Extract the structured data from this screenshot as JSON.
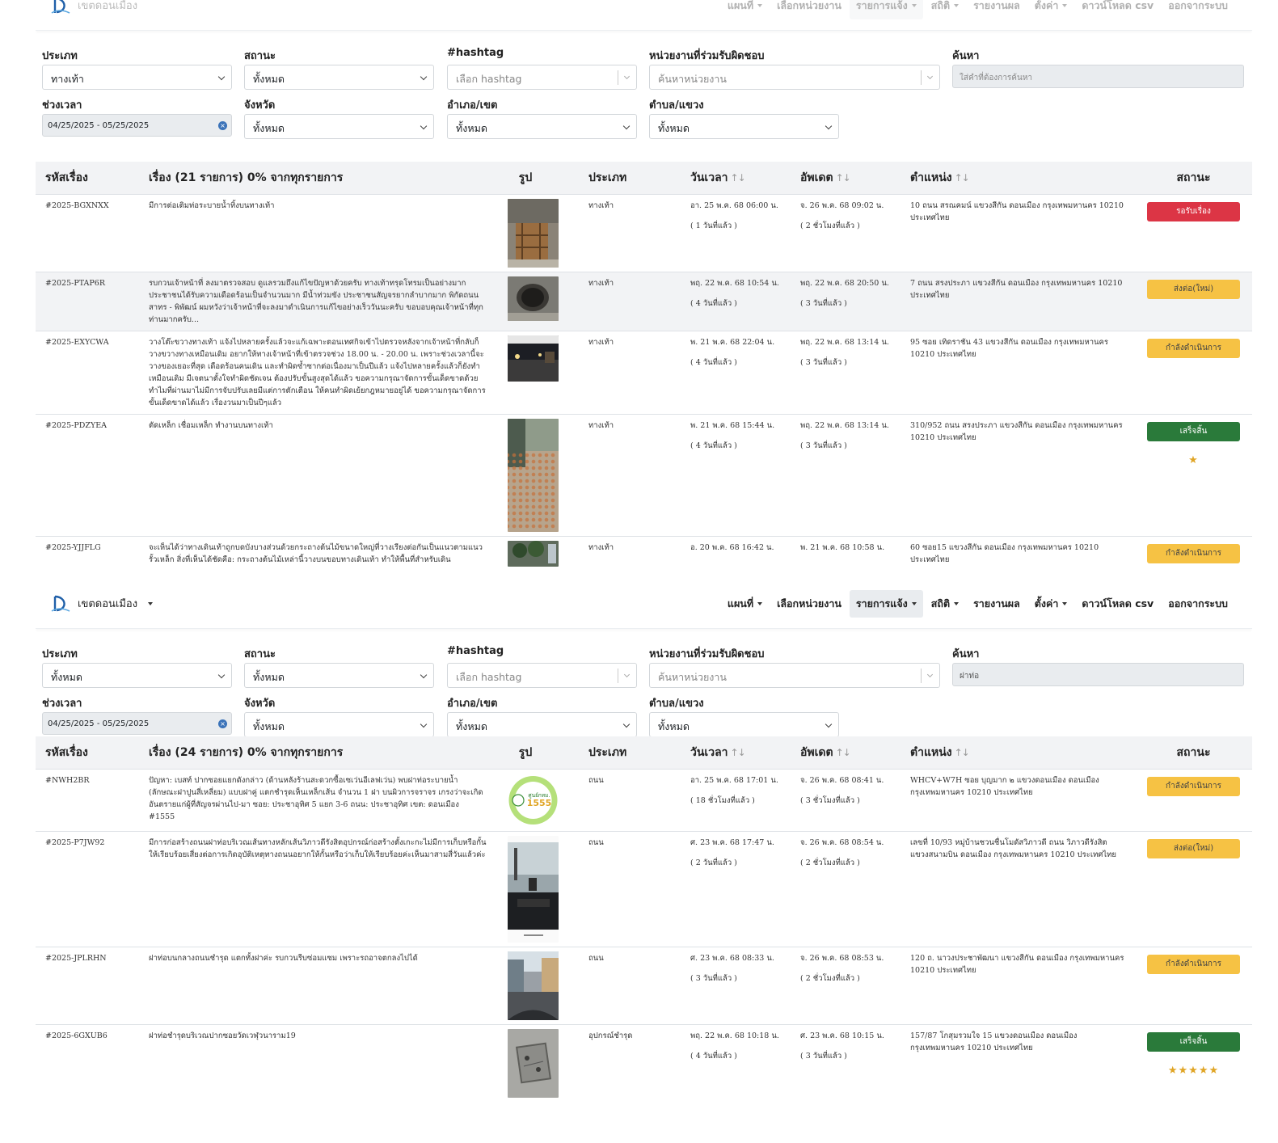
{
  "nav": {
    "brand_label": "เขตดอนเมือง",
    "items": [
      {
        "label": "แผนที่",
        "caret": true
      },
      {
        "label": "เลือกหน่วยงาน",
        "caret": false
      },
      {
        "label": "รายการแจ้ง",
        "caret": true,
        "active": true
      },
      {
        "label": "สถิติ",
        "caret": true
      },
      {
        "label": "รายงานผล",
        "caret": false
      },
      {
        "label": "ตั้งค่า",
        "caret": true
      },
      {
        "label": "ดาวน์โหลด csv",
        "caret": false
      },
      {
        "label": "ออกจากระบบ",
        "caret": false
      }
    ]
  },
  "filter_labels": {
    "type": "ประเภท",
    "status": "สถานะ",
    "hashtag": "#hashtag",
    "agency": "หน่วยงานที่ร่วมรับผิดชอบ",
    "search": "ค้นหา",
    "period": "ช่วงเวลา",
    "province": "จังหวัด",
    "district": "อำเภอ/เขต",
    "subdistrict": "ตำบล/แขวง"
  },
  "filter_placeholders": {
    "hashtag": "เลือก hashtag",
    "agency": "ค้นหาหน่วยงาน",
    "search": "ใส่คำที่ต้องการค้นหา"
  },
  "table_headers": {
    "code": "รหัสเรื่อง",
    "image": "รูป",
    "type": "ประเภท",
    "time": "วันเวลา",
    "updated": "อัพเดต",
    "location": "ตำแหน่ง",
    "status": "สถานะ"
  },
  "colors": {
    "red": "#dc3545",
    "yellow": "#f6c244",
    "green": "#2a7a3a",
    "active_nav": "#e9ecef",
    "header_bg": "#f2f3f5"
  },
  "panel1": {
    "filters": {
      "type": "ทางเท้า",
      "status": "ทั้งหมด",
      "search": "",
      "period": "04/25/2025 - 05/25/2025",
      "province": "ทั้งหมด",
      "district": "ทั้งหมด",
      "subdistrict": "ทั้งหมด"
    },
    "summary": "เรื่อง (21 รายการ) 0% จากทุกรายการ",
    "rows": [
      {
        "code": "#2025-BGXNXX",
        "desc": "มีการต่อเติมท่อระบายน้ำทิ้งบนทางเท้า",
        "type": "ทางเท้า",
        "time": "อา. 25 พ.ค. 68 06:00 น.",
        "time_ago": "( 1 วันที่แล้ว )",
        "updated": "จ. 26 พ.ค. 68 09:02 น.",
        "updated_ago": "( 2 ชั่วโมงที่แล้ว )",
        "location": "10 ถนน สรณคมน์ แขวงสีกัน ดอนเมือง กรุงเทพมหานคร 10210 ประเทศไทย",
        "status": "รอรับเรื่อง",
        "status_color": "red",
        "stars": 0,
        "image": "sidewalk-pipes"
      },
      {
        "code": "#2025-PTAP6R",
        "desc": "รบกวนเจ้าหน้าที่ ลงมาตรวจสอบ ดูแลรวมถึงแก้ไขปัญหาด้วยครับ ทางเท้าทรุดโทรมเป็นอย่างมาก ประชาชนได้รับความเดือดร้อนเป็นจำนวนมาก มีน้ำท่วมขัง ประชาชนสัญจรยากลำบากมาก พิกัดถนนสาทร - พิพัฒน์ ผมหวังว่าเจ้าหน้าที่จะลงมาดำเนินการแก้ไขอย่างเร็ววันนะครับ ขอบอบคุณเจ้าหน้าที่ทุกท่านมากครับ...",
        "type": "ทางเท้า",
        "time": "พฤ. 22 พ.ค. 68 10:54 น.",
        "time_ago": "( 4 วันที่แล้ว )",
        "updated": "พฤ. 22 พ.ค. 68 20:50 น.",
        "updated_ago": "( 3 วันที่แล้ว )",
        "location": "7 ถนน สรงประภา แขวงสีกัน ดอนเมือง กรุงเทพมหานคร 10210 ประเทศไทย",
        "status": "ส่งต่อ(ใหม่)",
        "status_color": "yellow",
        "stars": 0,
        "image": "manhole"
      },
      {
        "code": "#2025-EXYCWA",
        "desc": "วางโต๊ะขวางทางเท้า แจ้งไปหลายครั้งแล้วจะแก้เฉพาะตอนเทศกิจเข้าไปตรวจหลังจากเจ้าหน้าที่กลับก็วางขวางทางเหมือนเดิม อยากให้ทางเจ้าหน้าที่เข้าตรวจช่วง 18.00 น. - 20.00 น. เพราะช่วงเวลานี้จะวางของเยอะที่สุด เดือดร้อนคนเดิน และทำผิดซ้ำซากต่อเนื่องมาเป็นปีแล้ว แจ้งไปหลายครั้งแล้วก็ยังทำเหมือนเดิม มีเจตนาตั้งใจทำผิดชัดเจน ต้องปรับขั้นสูงสุดได้แล้ว ขอความกรุณาจัดการขั้นเด็ดขาดด้วย ทำไมที่ผ่านมาไม่มีการจับปรับเลยมีแต่การตักเตือน ให้คนทำผิดเย้ยกฎหมายอยู่ได้ ขอความกรุณาจัดการขั้นเด็ดขาดได้แล้ว เรื่องวนมาเป็นปีๆแล้ว",
        "type": "ทางเท้า",
        "time": "พ. 21 พ.ค. 68 22:04 น.",
        "time_ago": "( 4 วันที่แล้ว )",
        "updated": "พฤ. 22 พ.ค. 68 13:14 น.",
        "updated_ago": "( 3 วันที่แล้ว )",
        "location": "95 ซอย เทิดราชัน 43 แขวงสีกัน ดอนเมือง กรุงเทพมหานคร 10210 ประเทศไทย",
        "status": "กำลังดำเนินการ",
        "status_color": "yellow",
        "stars": 0,
        "image": "night-street"
      },
      {
        "code": "#2025-PDZYEA",
        "desc": "ตัดเหล็ก เชื่อมเหล็ก ทำงานบนทางเท้า",
        "type": "ทางเท้า",
        "time": "พ. 21 พ.ค. 68 15:44 น.",
        "time_ago": "( 4 วันที่แล้ว )",
        "updated": "พฤ. 22 พ.ค. 68 13:14 น.",
        "updated_ago": "( 3 วันที่แล้ว )",
        "location": "310/952 ถนน สรงประภา แขวงสีกัน ดอนเมือง กรุงเทพมหานคร 10210 ประเทศไทย",
        "status": "เสร็จสิ้น",
        "status_color": "green",
        "stars": 1,
        "image": "tiled-sidewalk"
      },
      {
        "code": "#2025-YJJFLG",
        "desc": "จะเห็นได้ว่าทางเดินเท้าถูกบดบังบางส่วนด้วยกระถางต้นไม้ขนาดใหญ่ที่วางเรียงต่อกันเป็นแนวตามแนวรั้วเหล็ก สิ่งที่เห็นได้ชัดคือ: กระถางต้นไม้เหล่านี้วางบนขอบทางเดินเท้า ทำให้พื้นที่สำหรับเดิน",
        "type": "ทางเท้า",
        "time": "อ. 20 พ.ค. 68 16:42 น.",
        "time_ago": "",
        "updated": "พ. 21 พ.ค. 68 10:58 น.",
        "updated_ago": "",
        "location": "60 ซอย15 แขวงสีกัน ดอนเมือง กรุงเทพมหานคร 10210 ประเทศไทย",
        "status": "กำลังดำเนินการ",
        "status_color": "yellow",
        "stars": 0,
        "image": "plants"
      }
    ]
  },
  "panel2": {
    "filters": {
      "type": "ทั้งหมด",
      "status": "ทั้งหมด",
      "search": "ฝาท่อ",
      "period": "04/25/2025 - 05/25/2025",
      "province": "ทั้งหมด",
      "district": "ทั้งหมด",
      "subdistrict": "ทั้งหมด"
    },
    "summary": "เรื่อง (24 รายการ) 0% จากทุกรายการ",
    "rows": [
      {
        "code": "#NWH2BR",
        "desc": "ปัญหา: เบสท์ ปากซอยแยกดังกล่าว (ด้านหลังร้านสะดวกซื้อเซเว่นอีเลฟเว่น) พบฝาท่อระบายน้ำ (ลักษณะฝาปูนสี่เหลี่ยม) แบบฝาคู่ แตกชำรุดเห็นเหล็กเส้น จำนวน 1 ฝา บนผิวการจราจร เกรงว่าจะเกิดอันตรายแก่ผู้ที่สัญจรผ่านไป-มา ซอย: ประชาอุทิศ 5 แยก 3-6 ถนน: ประชาอุทิศ เขต: ดอนเมือง #1555",
        "type": "ถนน",
        "time": "อา. 25 พ.ค. 68 17:01 น.",
        "time_ago": "( 18 ชั่วโมงที่แล้ว )",
        "updated": "จ. 26 พ.ค. 68 08:41 น.",
        "updated_ago": "( 3 ชั่วโมงที่แล้ว )",
        "location": "WHCV+W7H ซอย บุญมาก ๒ แขวงดอนเมือง ดอนเมือง กรุงเทพมหานคร 10210 ประเทศไทย",
        "status": "กำลังดำเนินการ",
        "status_color": "yellow",
        "stars": 0,
        "image": "logo-1555",
        "logo_top": "ศูนย์กทม.",
        "logo_num": "1555"
      },
      {
        "code": "#2025-P7JW92",
        "desc": "มีการก่อสร้างถนนฝาท่อบริเวณเส้นทางหลักเส้นวิภาวดีรังสิตอุปกรณ์ก่อสร้างตั้งเกะกะไม่มีการเก็บหรือกั้นให้เรียบร้อยเสี่ยงต่อการเกิดอุบัติเหตุทางถนนอยากให้กั้นหรือว่าเก็บให้เรียบร้อยค่ะเห็นมาสามสี่วันแล้วค่ะ",
        "type": "ถนน",
        "time": "ศ. 23 พ.ค. 68 17:47 น.",
        "time_ago": "( 2 วันที่แล้ว )",
        "updated": "จ. 26 พ.ค. 68 08:54 น.",
        "updated_ago": "( 2 ชั่วโมงที่แล้ว )",
        "location": "เลขที่ 10/93 หมู่บ้านชวนชื่นโมดัสวิภาวดี ถนน วิภาวดีรังสิต แขวงสนามบิน ดอนเมือง กรุงเทพมหานคร 10210 ประเทศไทย",
        "status": "ส่งต่อ(ใหม่)",
        "status_color": "yellow",
        "stars": 0,
        "image": "car-screenshot"
      },
      {
        "code": "#2025-JPLRHN",
        "desc": "ฝาท่อบนกลางถนนชำรุด แตกทั้งฝาค่ะ รบกวนรีบซ่อมแซม เพราะรถอาจตกลงไปได้",
        "type": "ถนน",
        "time": "ศ. 23 พ.ค. 68 08:33 น.",
        "time_ago": "( 3 วันที่แล้ว )",
        "updated": "จ. 26 พ.ค. 68 08:53 น.",
        "updated_ago": "( 2 ชั่วโมงที่แล้ว )",
        "location": "120 ถ. นาวงประชาพัฒนา แขวงสีกัน ดอนเมือง กรุงเทพมหานคร 10210 ประเทศไทย",
        "status": "กำลังดำเนินการ",
        "status_color": "yellow",
        "stars": 0,
        "image": "street-buildings"
      },
      {
        "code": "#2025-6GXUB6",
        "desc": "ฝาท่อชำรุดบริเวณปากซอยวัดเวฬุวนาราม19",
        "type": "อุปกรณ์ชำรุด",
        "time": "พฤ. 22 พ.ค. 68 10:18 น.",
        "time_ago": "( 4 วันที่แล้ว )",
        "updated": "ศ. 23 พ.ค. 68 10:15 น.",
        "updated_ago": "( 3 วันที่แล้ว )",
        "location": "157/87 โกสุมรวมใจ 15 แขวงดอนเมือง ดอนเมือง กรุงเทพมหานคร 10210 ประเทศไทย",
        "status": "เสร็จสิ้น",
        "status_color": "green",
        "stars": 5,
        "image": "drain-cover"
      }
    ]
  }
}
